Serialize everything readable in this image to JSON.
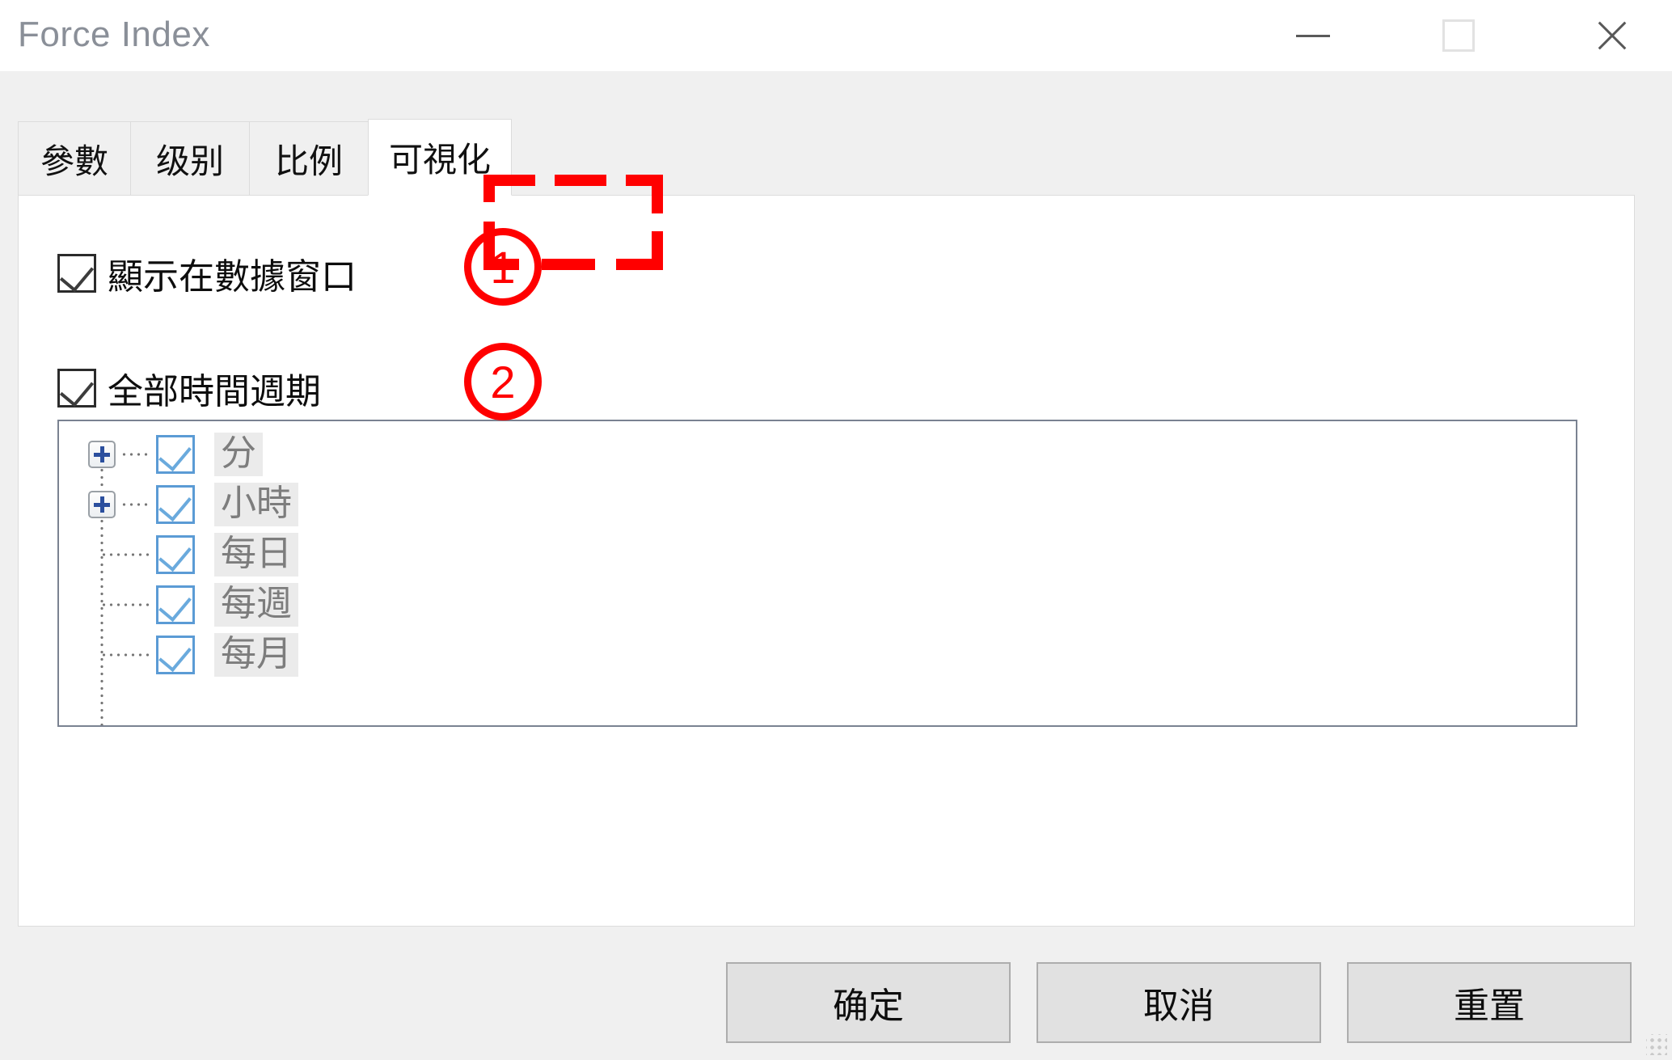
{
  "window": {
    "title": "Force Index",
    "controls": {
      "minimize": "minimize-icon",
      "maximize": "maximize-icon",
      "close": "close-icon"
    }
  },
  "tabs": [
    {
      "label": "參數",
      "active": false
    },
    {
      "label": "级别",
      "active": false
    },
    {
      "label": "比例",
      "active": false
    },
    {
      "label": "可視化",
      "active": true
    }
  ],
  "options": [
    {
      "label": "顯示在數據窗口",
      "checked": true,
      "annotation": "①"
    },
    {
      "label": "全部時間週期",
      "checked": true,
      "annotation": "②"
    }
  ],
  "annotations": [
    {
      "number": "1",
      "color": "#ff0000"
    },
    {
      "number": "2",
      "color": "#ff0000"
    }
  ],
  "tree": {
    "items": [
      {
        "label": "分",
        "checked": true,
        "expandable": true
      },
      {
        "label": "小時",
        "checked": true,
        "expandable": true
      },
      {
        "label": "每日",
        "checked": true,
        "expandable": false
      },
      {
        "label": "每週",
        "checked": true,
        "expandable": false
      },
      {
        "label": "每月",
        "checked": true,
        "expandable": false
      }
    ]
  },
  "footer": {
    "ok": "确定",
    "cancel": "取消",
    "reset": "重置"
  },
  "colors": {
    "accent_red": "#ff0000",
    "tree_checkbox_blue": "#5b9bd5",
    "expander_plus_blue": "#2b4f9e",
    "title_gray": "#8a8f98",
    "panel_white": "#ffffff",
    "dialog_gray": "#f0f0f0",
    "button_face": "#e1e1e1",
    "tree_label_text": "#7d7d7d",
    "tree_label_highlight": "#ebebeb"
  }
}
